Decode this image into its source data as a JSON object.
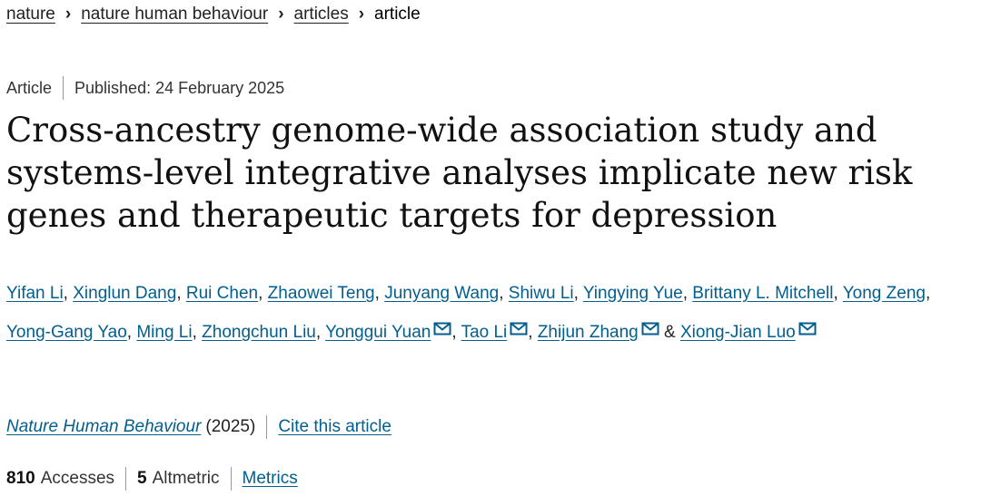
{
  "breadcrumb": {
    "items": [
      "nature",
      "nature human behaviour",
      "articles"
    ],
    "current": "article"
  },
  "meta": {
    "type": "Article",
    "published": "Published: 24 February 2025"
  },
  "title": "Cross-ancestry genome-wide association study and systems-level integrative analyses implicate new risk genes and therapeutic targets for depression",
  "authors": [
    {
      "name": "Yifan Li",
      "email": false
    },
    {
      "name": "Xinglun Dang",
      "email": false
    },
    {
      "name": "Rui Chen",
      "email": false
    },
    {
      "name": "Zhaowei Teng",
      "email": false
    },
    {
      "name": "Junyang Wang",
      "email": false
    },
    {
      "name": "Shiwu Li",
      "email": false
    },
    {
      "name": "Yingying Yue",
      "email": false
    },
    {
      "name": "Brittany L. Mitchell",
      "email": false
    },
    {
      "name": "Yong Zeng",
      "email": false
    },
    {
      "name": "Yong-Gang Yao",
      "email": false
    },
    {
      "name": "Ming Li",
      "email": false
    },
    {
      "name": "Zhongchun Liu",
      "email": false
    },
    {
      "name": "Yonggui Yuan",
      "email": true
    },
    {
      "name": "Tao Li",
      "email": true
    },
    {
      "name": "Zhijun Zhang",
      "email": true
    },
    {
      "name": "Xiong-Jian Luo",
      "email": true
    }
  ],
  "author_separator": ", ",
  "author_last_joiner": " & ",
  "journal": {
    "name": "Nature Human Behaviour",
    "year": "(2025)",
    "cite_label": "Cite this article"
  },
  "metrics": {
    "accesses_count": "810",
    "accesses_label": "Accesses",
    "altmetric_count": "5",
    "altmetric_label": "Altmetric",
    "metrics_link": "Metrics"
  },
  "colors": {
    "link": "#025e8d",
    "text": "#222222",
    "divider": "#999999"
  },
  "icons": {
    "email": "envelope-icon",
    "breadcrumb_separator": "chevron-right-icon"
  }
}
